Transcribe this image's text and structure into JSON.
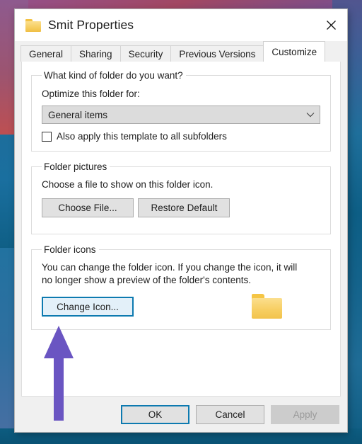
{
  "window": {
    "title": "Smit Properties",
    "title_icon": "folder-icon",
    "close_label": "✕"
  },
  "tabs": [
    {
      "label": "General",
      "selected": false
    },
    {
      "label": "Sharing",
      "selected": false
    },
    {
      "label": "Security",
      "selected": false
    },
    {
      "label": "Previous Versions",
      "selected": false
    },
    {
      "label": "Customize",
      "selected": true
    }
  ],
  "folder_kind_group": {
    "legend": "What kind of folder do you want?",
    "optimize_label": "Optimize this folder for:",
    "combo_value": "General items",
    "combo_arrow_icon": "chevron-down-icon",
    "checkbox_label": "Also apply this template to all subfolders",
    "checkbox_checked": false
  },
  "folder_pictures_group": {
    "legend": "Folder pictures",
    "description": "Choose a file to show on this folder icon.",
    "choose_file_label": "Choose File...",
    "restore_default_label": "Restore Default"
  },
  "folder_icons_group": {
    "legend": "Folder icons",
    "description": "You can change the folder icon. If you change the icon, it will no longer show a preview of the folder's contents.",
    "change_icon_label": "Change Icon...",
    "preview_icon": "folder-icon"
  },
  "footer": {
    "ok_label": "OK",
    "cancel_label": "Cancel",
    "apply_label": "Apply",
    "apply_disabled": true
  },
  "annotation": {
    "type": "arrow-up",
    "color": "#6a55c2",
    "points_at": "change-icon-button"
  },
  "colors": {
    "accent_focus": "#0d7ab0",
    "highlight_fill": "#e3f0f9",
    "folder_yellow": "#f5c544",
    "arrow_purple": "#6a55c2",
    "dialog_chrome": "#f0f0f0"
  }
}
